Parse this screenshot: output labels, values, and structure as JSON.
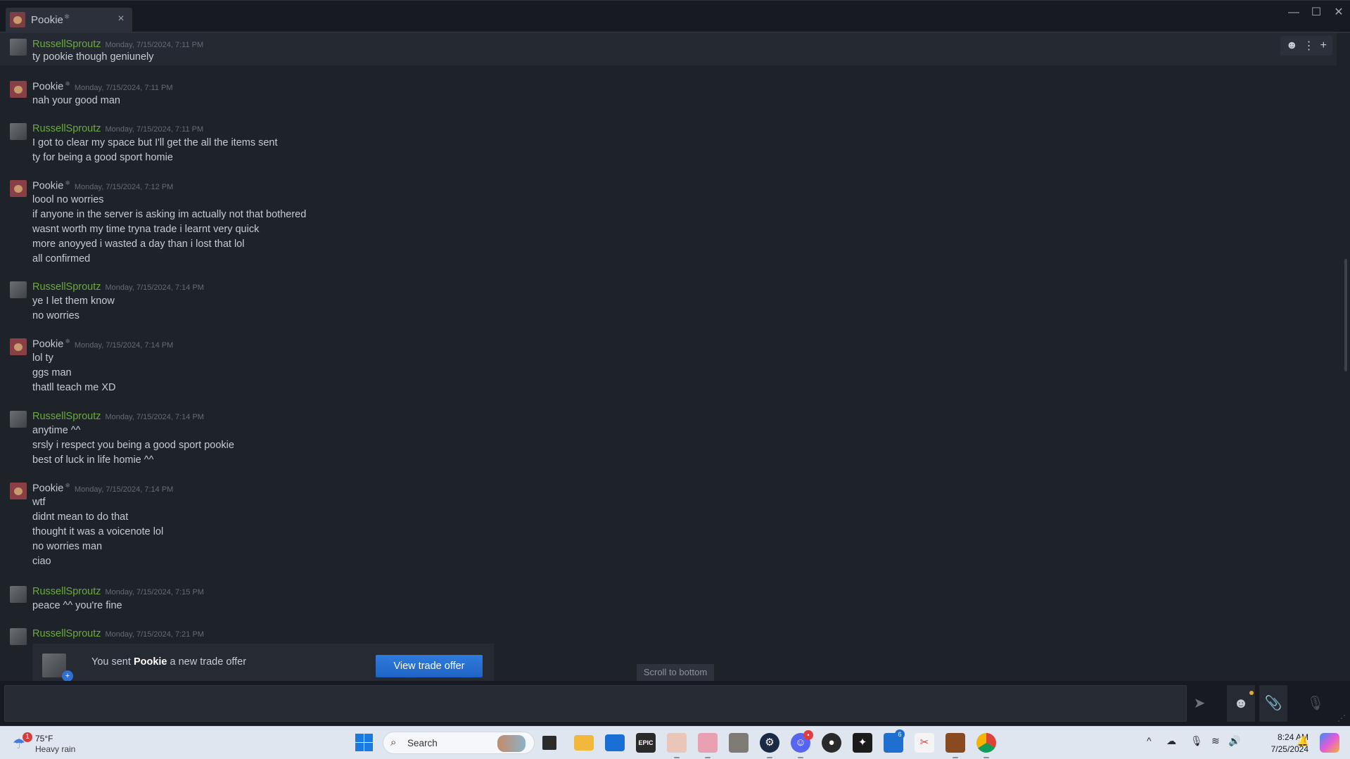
{
  "window": {
    "tab_title": "Pookie",
    "tab_symbol": "❄",
    "tab_close": "×",
    "minimize": "—",
    "maximize": "☐",
    "close": "✕"
  },
  "messages": [
    {
      "sender": "RussellSproutz",
      "kind": "rs",
      "time": "Monday, 7/15/2024, 7:11 PM",
      "lines": [
        "ty pookie though geniunely"
      ]
    },
    {
      "sender": "Pookie",
      "kind": "pk",
      "time": "Monday, 7/15/2024, 7:11 PM",
      "lines": [
        "nah your good man"
      ]
    },
    {
      "sender": "RussellSproutz",
      "kind": "rs",
      "time": "Monday, 7/15/2024, 7:11 PM",
      "lines": [
        "I got to clear my space but I'll get the all the items sent",
        "ty for being a good sport homie"
      ]
    },
    {
      "sender": "Pookie",
      "kind": "pk",
      "time": "Monday, 7/15/2024, 7:12 PM",
      "lines": [
        "loool no worries",
        "if anyone in the server is asking im actually not that bothered",
        "wasnt worth my time tryna trade i learnt very quick",
        "more anoyyed i wasted a day than i lost that lol",
        "all confirmed"
      ]
    },
    {
      "sender": "RussellSproutz",
      "kind": "rs",
      "time": "Monday, 7/15/2024, 7:14 PM",
      "lines": [
        "ye I let them know",
        "no worries"
      ]
    },
    {
      "sender": "Pookie",
      "kind": "pk",
      "time": "Monday, 7/15/2024, 7:14 PM",
      "lines": [
        "lol ty",
        "ggs man",
        "thatll teach me XD"
      ]
    },
    {
      "sender": "RussellSproutz",
      "kind": "rs",
      "time": "Monday, 7/15/2024, 7:14 PM",
      "lines": [
        "anytime ^^",
        "srsly i respect you being a good sport pookie",
        "best of luck in life homie ^^"
      ]
    },
    {
      "sender": "Pookie",
      "kind": "pk",
      "time": "Monday, 7/15/2024, 7:14 PM",
      "lines": [
        "wtf",
        "didnt mean to do that",
        "thought it was a voicenote lol",
        "no worries man",
        "ciao"
      ]
    },
    {
      "sender": "RussellSproutz",
      "kind": "rs",
      "time": "Monday, 7/15/2024, 7:15 PM",
      "lines": [
        "peace ^^ you're fine"
      ]
    },
    {
      "sender": "RussellSproutz",
      "kind": "rs",
      "time": "Monday, 7/15/2024, 7:21 PM",
      "lines": []
    }
  ],
  "sender_symbol": "❄",
  "trade_offer": {
    "prefix": "You sent ",
    "recipient": "Pookie",
    "suffix": " a new trade offer",
    "badge": "+",
    "button_label": "View trade offer"
  },
  "scroll_to_bottom": "Scroll to bottom",
  "hover_tools": {
    "emoji": "☻",
    "more": "⋮",
    "add": "+"
  },
  "composer": {
    "placeholder": "",
    "send_icon": "➤",
    "emoji_icon": "☻",
    "attach_icon": "📎",
    "voice_icon": "🎙",
    "grip": "⋰"
  },
  "taskbar": {
    "weather_temp": "75°F",
    "weather_desc": "Heavy rain",
    "weather_badge": "1",
    "search_label": "Search",
    "discord_badge": "•",
    "app_badge": "6",
    "clock_time": "8:24 AM",
    "clock_date": "7/25/2024",
    "tray_up": "^",
    "tray_cloud": "☁",
    "tray_mic": "🎙",
    "tray_wifi": "≋",
    "tray_volume": "🔊",
    "tray_bell": "🔔"
  }
}
